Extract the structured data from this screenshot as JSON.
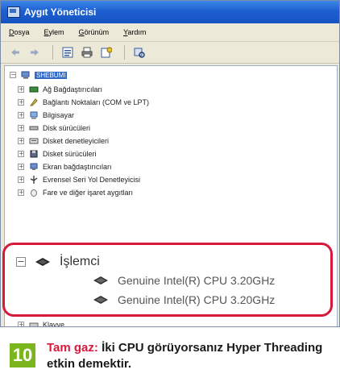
{
  "window": {
    "title": "Aygıt Yöneticisi"
  },
  "menu": [
    "Dosya",
    "Eylem",
    "Görünüm",
    "Yardım"
  ],
  "toolbar": {
    "buttons": [
      "back-arrow-icon",
      "forward-arrow-icon",
      "properties-icon",
      "print-icon",
      "help-icon",
      "scan-icon"
    ]
  },
  "tree": {
    "root": "SHEBUMI",
    "items": [
      "Ağ Bağdaştırıcıları",
      "Bağlantı Noktaları (COM ve LPT)",
      "Bilgisayar",
      "Disk sürücüleri",
      "Disket denetleyicileri",
      "Disket sürücüleri",
      "Ekran bağdaştırıcıları",
      "Evrensel Seri Yol Denetleyicisi",
      "Fare ve diğer işaret aygıtları"
    ],
    "highlight": {
      "category": "İşlemci",
      "children": [
        "Genuine Intel(R) CPU 3.20GHz",
        "Genuine Intel(R) CPU 3.20GHz"
      ]
    },
    "after": "Klavye"
  },
  "caption": {
    "step": "10",
    "heading": "Tam gaz:",
    "text": "İki CPU görüyorsanız Hyper Threading etkin demektir."
  },
  "colors": {
    "accent_red": "#d7193b",
    "step_green": "#7ab51d",
    "titlebar_blue": "#1c5fd0"
  }
}
